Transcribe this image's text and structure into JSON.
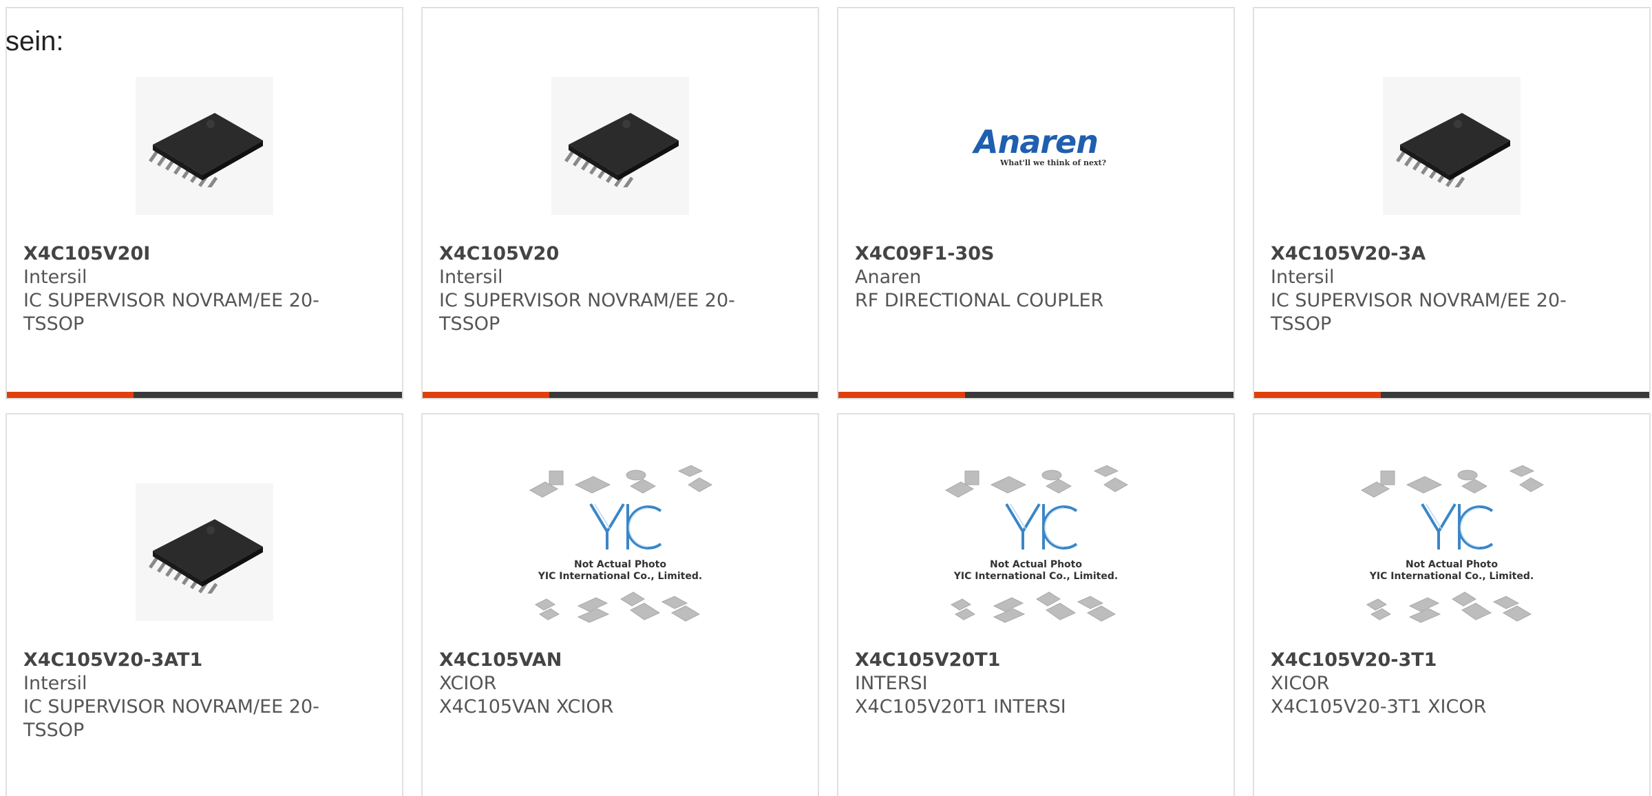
{
  "lead_text": "sein:",
  "colors": {
    "accent": "#e0400e",
    "bar": "#3a3a3a",
    "border": "#e0e0e0",
    "anaren_blue": "#1f5fb0",
    "yic_blue": "#3a86c8"
  },
  "products": [
    {
      "part": "X4C105V20I",
      "maker": "Intersil",
      "desc": "IC SUPERVISOR NOVRAM/EE 20-TSSOP",
      "image": "tssop-chip-icon"
    },
    {
      "part": "X4C105V20",
      "maker": "Intersil",
      "desc": "IC SUPERVISOR NOVRAM/EE 20-TSSOP",
      "image": "tssop-chip-icon"
    },
    {
      "part": "X4C09F1-30S",
      "maker": "Anaren",
      "desc": "RF DIRECTIONAL COUPLER",
      "image": "anaren-logo",
      "logo_text": "Anaren",
      "logo_tagline": "What'll we think of next?"
    },
    {
      "part": "X4C105V20-3A",
      "maker": "Intersil",
      "desc": "IC SUPERVISOR NOVRAM/EE 20-TSSOP",
      "image": "tssop-chip-icon"
    },
    {
      "part": "X4C105V20-3AT1",
      "maker": "Intersil",
      "desc": "IC SUPERVISOR NOVRAM/EE 20-TSSOP",
      "image": "tssop-chip-icon"
    },
    {
      "part": "X4C105VAN",
      "maker": "XCIOR",
      "desc": "X4C105VAN XCIOR",
      "image": "not-actual-photo-placeholder",
      "placeholder_line1": "Not Actual Photo",
      "placeholder_line2": "YIC International Co., Limited."
    },
    {
      "part": "X4C105V20T1",
      "maker": "INTERSI",
      "desc": "X4C105V20T1 INTERSI",
      "image": "not-actual-photo-placeholder",
      "placeholder_line1": "Not Actual Photo",
      "placeholder_line2": "YIC International Co., Limited."
    },
    {
      "part": "X4C105V20-3T1",
      "maker": "XICOR",
      "desc": "X4C105V20-3T1 XICOR",
      "image": "not-actual-photo-placeholder",
      "placeholder_line1": "Not Actual Photo",
      "placeholder_line2": "YIC International Co., Limited."
    }
  ]
}
